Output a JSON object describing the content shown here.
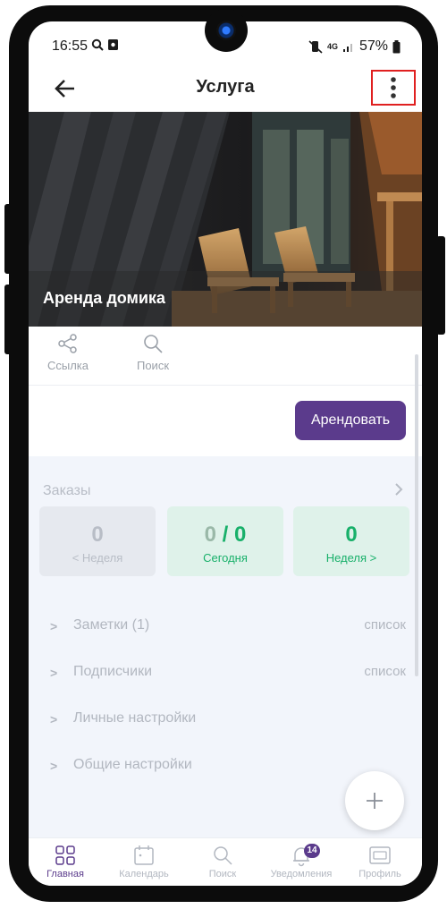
{
  "status_bar": {
    "time": "16:55",
    "network": "4G",
    "battery": "57%"
  },
  "app_bar": {
    "title": "Услуга"
  },
  "hero": {
    "caption": "Аренда домика"
  },
  "actions": {
    "link_label": "Ссылка",
    "search_label": "Поиск"
  },
  "rent_button": {
    "label": "Арендовать"
  },
  "orders": {
    "header": "Заказы",
    "prev_week": {
      "value": "0",
      "label": "< Неделя"
    },
    "today": {
      "value_a": "0",
      "separator": "/",
      "value_b": "0",
      "label": "Сегодня"
    },
    "next_week": {
      "value": "0",
      "label": "Неделя >"
    }
  },
  "menu": {
    "notes": {
      "label": "Заметки (1)",
      "right": "список"
    },
    "subscribers": {
      "label": "Подписчики",
      "right": "список"
    },
    "personal_settings": {
      "label": "Личные настройки"
    },
    "general_settings": {
      "label": "Общие настройки"
    }
  },
  "bottom_nav": {
    "home": "Главная",
    "calendar": "Календарь",
    "search": "Поиск",
    "notifications": "Уведомления",
    "notifications_badge": "14",
    "profile": "Профиль"
  },
  "colors": {
    "accent": "#5b3b8c",
    "success": "#18b06a",
    "highlight_border": "#e02020"
  }
}
